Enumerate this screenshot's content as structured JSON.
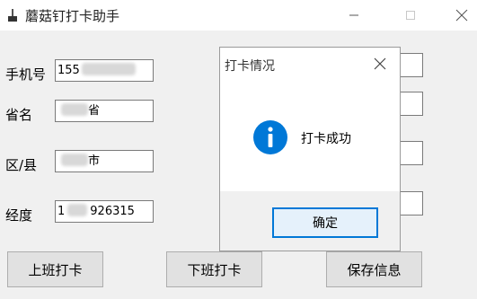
{
  "window": {
    "title": "蘑菇钉打卡助手",
    "icons": {
      "app": "broom-icon",
      "minimize": "minimize-icon",
      "maximize": "maximize-icon",
      "close": "close-icon"
    }
  },
  "form": {
    "phone": {
      "label": "手机号",
      "value_visible": "155"
    },
    "province": {
      "label": "省名",
      "value_visible": "省"
    },
    "district": {
      "label": "区/县",
      "value_visible": "市"
    },
    "longitude": {
      "label": "经度",
      "value_prefix": "1",
      "value_suffix": "926315"
    }
  },
  "buttons": {
    "clock_in": "上班打卡",
    "clock_out": "下班打卡",
    "save": "保存信息"
  },
  "dialog": {
    "title": "打卡情况",
    "message": "打卡成功",
    "ok": "确定",
    "icon": "info-icon",
    "accent": "#0078d7"
  }
}
